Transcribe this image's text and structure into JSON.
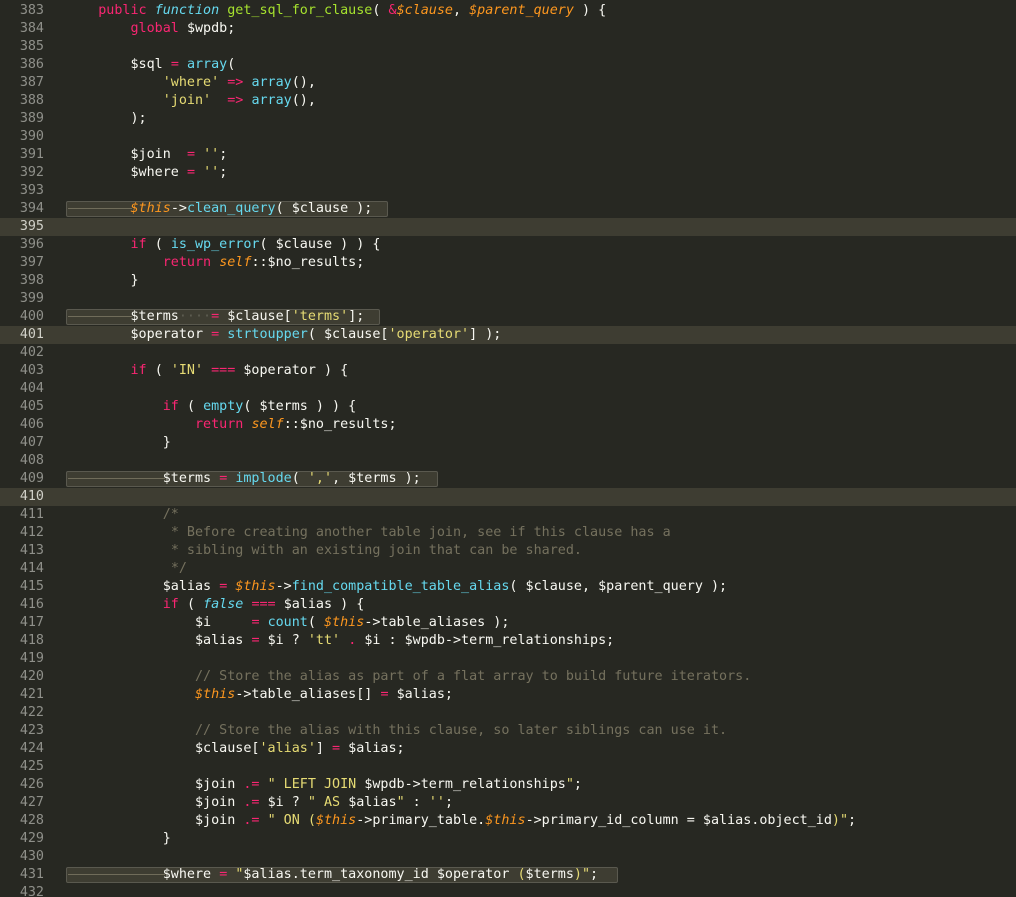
{
  "editor": {
    "theme": "Monokai",
    "colors": {
      "background": "#272822",
      "current_line": "#3e3d32",
      "gutter_text": "#8f908a",
      "keyword": "#f92672",
      "function": "#a6e22e",
      "builtin": "#66d9ef",
      "string": "#e6db74",
      "comment": "#75715e",
      "parameter": "#fd971f"
    },
    "current_lines": [
      395,
      401,
      410
    ],
    "lines": [
      {
        "n": "383",
        "t": [
          [
            "    ",
            ""
          ],
          [
            "public ",
            "kw"
          ],
          [
            "function ",
            "st"
          ],
          [
            "get_sql_for_clause",
            "fn"
          ],
          [
            "( ",
            ""
          ],
          [
            "&",
            "op"
          ],
          [
            "$clause",
            "pa"
          ],
          [
            ", ",
            ""
          ],
          [
            "$parent_query",
            "pa"
          ],
          [
            " ) {",
            ""
          ]
        ]
      },
      {
        "n": "384",
        "t": [
          [
            "        ",
            ""
          ],
          [
            "global ",
            "kw"
          ],
          [
            "$wpdb;",
            ""
          ]
        ]
      },
      {
        "n": "385",
        "t": []
      },
      {
        "n": "386",
        "t": [
          [
            "        $sql ",
            ""
          ],
          [
            "= ",
            "op"
          ],
          [
            "array",
            "bi"
          ],
          [
            "(",
            ""
          ]
        ]
      },
      {
        "n": "387",
        "t": [
          [
            "            ",
            ""
          ],
          [
            "'where'",
            "s"
          ],
          [
            " ",
            ""
          ],
          [
            "=> ",
            "op"
          ],
          [
            "array",
            "bi"
          ],
          [
            "(),",
            ""
          ]
        ]
      },
      {
        "n": "388",
        "t": [
          [
            "            ",
            ""
          ],
          [
            "'join'",
            "s"
          ],
          [
            "  ",
            ""
          ],
          [
            "=> ",
            "op"
          ],
          [
            "array",
            "bi"
          ],
          [
            "(),",
            ""
          ]
        ]
      },
      {
        "n": "389",
        "t": [
          [
            "        );",
            ""
          ]
        ]
      },
      {
        "n": "390",
        "t": []
      },
      {
        "n": "391",
        "t": [
          [
            "        $join  ",
            ""
          ],
          [
            "= ",
            "op"
          ],
          [
            "''",
            "s"
          ],
          [
            ";",
            ""
          ]
        ]
      },
      {
        "n": "392",
        "t": [
          [
            "        $where ",
            ""
          ],
          [
            "= ",
            "op"
          ],
          [
            "''",
            "s"
          ],
          [
            ";",
            ""
          ]
        ]
      },
      {
        "n": "393",
        "t": []
      },
      {
        "n": "394",
        "t": [
          [
            "        ",
            ""
          ],
          [
            "$this",
            "this"
          ],
          [
            "->",
            ""
          ],
          [
            "clean_query",
            "bi"
          ],
          [
            "( ",
            ""
          ],
          [
            "$clause",
            ""
          ],
          [
            " );",
            ""
          ]
        ],
        "hl": [
          0,
          322
        ],
        "arrow": [
          0,
          64
        ]
      },
      {
        "n": "395",
        "t": []
      },
      {
        "n": "396",
        "t": [
          [
            "        ",
            ""
          ],
          [
            "if ",
            "kw"
          ],
          [
            "( ",
            ""
          ],
          [
            "is_wp_error",
            "bi"
          ],
          [
            "( $clause ) ) {",
            ""
          ]
        ]
      },
      {
        "n": "397",
        "t": [
          [
            "            ",
            ""
          ],
          [
            "return ",
            "kw"
          ],
          [
            "self",
            "this"
          ],
          [
            "::$no_results;",
            ""
          ]
        ]
      },
      {
        "n": "398",
        "t": [
          [
            "        }",
            ""
          ]
        ]
      },
      {
        "n": "399",
        "t": []
      },
      {
        "n": "400",
        "t": [
          [
            "        $terms",
            ""
          ],
          [
            "····",
            "ws"
          ],
          [
            "= ",
            "op"
          ],
          [
            "$clause[",
            ""
          ],
          [
            "'terms'",
            "s"
          ],
          [
            "];",
            ""
          ]
        ],
        "hl": [
          0,
          314
        ],
        "arrow": [
          0,
          64
        ]
      },
      {
        "n": "401",
        "t": [
          [
            "        $operator ",
            ""
          ],
          [
            "= ",
            "op"
          ],
          [
            "strtoupper",
            "bi"
          ],
          [
            "( $clause[",
            ""
          ],
          [
            "'operator'",
            "s"
          ],
          [
            "] );",
            ""
          ]
        ]
      },
      {
        "n": "402",
        "t": []
      },
      {
        "n": "403",
        "t": [
          [
            "        ",
            ""
          ],
          [
            "if ",
            "kw"
          ],
          [
            "( ",
            ""
          ],
          [
            "'IN'",
            "s"
          ],
          [
            " ",
            ""
          ],
          [
            "=== ",
            "op"
          ],
          [
            "$operator ) {",
            ""
          ]
        ]
      },
      {
        "n": "404",
        "t": []
      },
      {
        "n": "405",
        "t": [
          [
            "            ",
            ""
          ],
          [
            "if ",
            "kw"
          ],
          [
            "( ",
            ""
          ],
          [
            "empty",
            "bi"
          ],
          [
            "( $terms ) ) {",
            ""
          ]
        ]
      },
      {
        "n": "406",
        "t": [
          [
            "                ",
            ""
          ],
          [
            "return ",
            "kw"
          ],
          [
            "self",
            "this"
          ],
          [
            "::$no_results;",
            ""
          ]
        ]
      },
      {
        "n": "407",
        "t": [
          [
            "            }",
            ""
          ]
        ]
      },
      {
        "n": "408",
        "t": []
      },
      {
        "n": "409",
        "t": [
          [
            "            $terms ",
            ""
          ],
          [
            "= ",
            "op"
          ],
          [
            "implode",
            "bi"
          ],
          [
            "( ",
            ""
          ],
          [
            "','",
            "s"
          ],
          [
            ", $terms );",
            ""
          ]
        ],
        "hl": [
          0,
          372
        ],
        "arrow": [
          0,
          97
        ]
      },
      {
        "n": "410",
        "t": []
      },
      {
        "n": "411",
        "t": [
          [
            "            ",
            ""
          ],
          [
            "/*",
            "c"
          ]
        ]
      },
      {
        "n": "412",
        "t": [
          [
            "             ",
            ""
          ],
          [
            "* Before creating another table join, see if this clause has a",
            "c"
          ]
        ]
      },
      {
        "n": "413",
        "t": [
          [
            "             ",
            ""
          ],
          [
            "* sibling with an existing join that can be shared.",
            "c"
          ]
        ]
      },
      {
        "n": "414",
        "t": [
          [
            "             ",
            ""
          ],
          [
            "*/",
            "c"
          ]
        ]
      },
      {
        "n": "415",
        "t": [
          [
            "            $alias ",
            ""
          ],
          [
            "= ",
            "op"
          ],
          [
            "$this",
            "this"
          ],
          [
            "->",
            ""
          ],
          [
            "find_compatible_table_alias",
            "bi"
          ],
          [
            "( $clause, $parent_query );",
            ""
          ]
        ]
      },
      {
        "n": "416",
        "t": [
          [
            "            ",
            ""
          ],
          [
            "if ",
            "kw"
          ],
          [
            "( ",
            ""
          ],
          [
            "false ",
            "st"
          ],
          [
            "=== ",
            "op"
          ],
          [
            "$alias ) {",
            ""
          ]
        ]
      },
      {
        "n": "417",
        "t": [
          [
            "                $i     ",
            ""
          ],
          [
            "= ",
            "op"
          ],
          [
            "count",
            "bi"
          ],
          [
            "( ",
            ""
          ],
          [
            "$this",
            "this"
          ],
          [
            "->table_aliases );",
            ""
          ]
        ]
      },
      {
        "n": "418",
        "t": [
          [
            "                $alias ",
            ""
          ],
          [
            "= ",
            "op"
          ],
          [
            "$i ? ",
            ""
          ],
          [
            "'tt'",
            "s"
          ],
          [
            " ",
            ""
          ],
          [
            ". ",
            "op"
          ],
          [
            "$i : $wpdb->term_relationships;",
            ""
          ]
        ]
      },
      {
        "n": "419",
        "t": []
      },
      {
        "n": "420",
        "t": [
          [
            "                ",
            ""
          ],
          [
            "// Store the alias as part of a flat array to build future iterators.",
            "c"
          ]
        ]
      },
      {
        "n": "421",
        "t": [
          [
            "                ",
            ""
          ],
          [
            "$this",
            "this"
          ],
          [
            "->table_aliases[] ",
            ""
          ],
          [
            "= ",
            "op"
          ],
          [
            "$alias;",
            ""
          ]
        ]
      },
      {
        "n": "422",
        "t": []
      },
      {
        "n": "423",
        "t": [
          [
            "                ",
            ""
          ],
          [
            "// Store the alias with this clause, so later siblings can use it.",
            "c"
          ]
        ]
      },
      {
        "n": "424",
        "t": [
          [
            "                $clause[",
            ""
          ],
          [
            "'alias'",
            "s"
          ],
          [
            "] ",
            ""
          ],
          [
            "= ",
            "op"
          ],
          [
            "$alias;",
            ""
          ]
        ]
      },
      {
        "n": "425",
        "t": []
      },
      {
        "n": "426",
        "t": [
          [
            "                $join ",
            ""
          ],
          [
            ".= ",
            "op"
          ],
          [
            "\" LEFT JOIN ",
            "s"
          ],
          [
            "$wpdb->term_relationships",
            ""
          ],
          [
            "\"",
            "s"
          ],
          [
            ";",
            ""
          ]
        ]
      },
      {
        "n": "427",
        "t": [
          [
            "                $join ",
            ""
          ],
          [
            ".= ",
            "op"
          ],
          [
            "$i ? ",
            ""
          ],
          [
            "\" AS ",
            "s"
          ],
          [
            "$alias",
            ""
          ],
          [
            "\"",
            "s"
          ],
          [
            " : ",
            ""
          ],
          [
            "''",
            "s"
          ],
          [
            ";",
            ""
          ]
        ]
      },
      {
        "n": "428",
        "t": [
          [
            "                $join ",
            ""
          ],
          [
            ".= ",
            "op"
          ],
          [
            "\" ON (",
            "s"
          ],
          [
            "$this",
            "this"
          ],
          [
            "->primary_table.",
            ""
          ],
          [
            "$this",
            "this"
          ],
          [
            "->primary_id_column = $alias.object_id",
            ""
          ],
          [
            ")\"",
            "s"
          ],
          [
            ";",
            ""
          ]
        ]
      },
      {
        "n": "429",
        "t": [
          [
            "            }",
            ""
          ]
        ]
      },
      {
        "n": "430",
        "t": []
      },
      {
        "n": "431",
        "t": [
          [
            "            $where ",
            ""
          ],
          [
            "= ",
            "op"
          ],
          [
            "\"",
            "s"
          ],
          [
            "$alias.term_taxonomy_id $operator",
            ""
          ],
          [
            " (",
            "s"
          ],
          [
            "$terms",
            ""
          ],
          [
            ")\"",
            "s"
          ],
          [
            ";",
            ""
          ]
        ],
        "hl": [
          0,
          552
        ],
        "arrow": [
          0,
          97
        ]
      },
      {
        "n": "432",
        "t": []
      }
    ]
  }
}
